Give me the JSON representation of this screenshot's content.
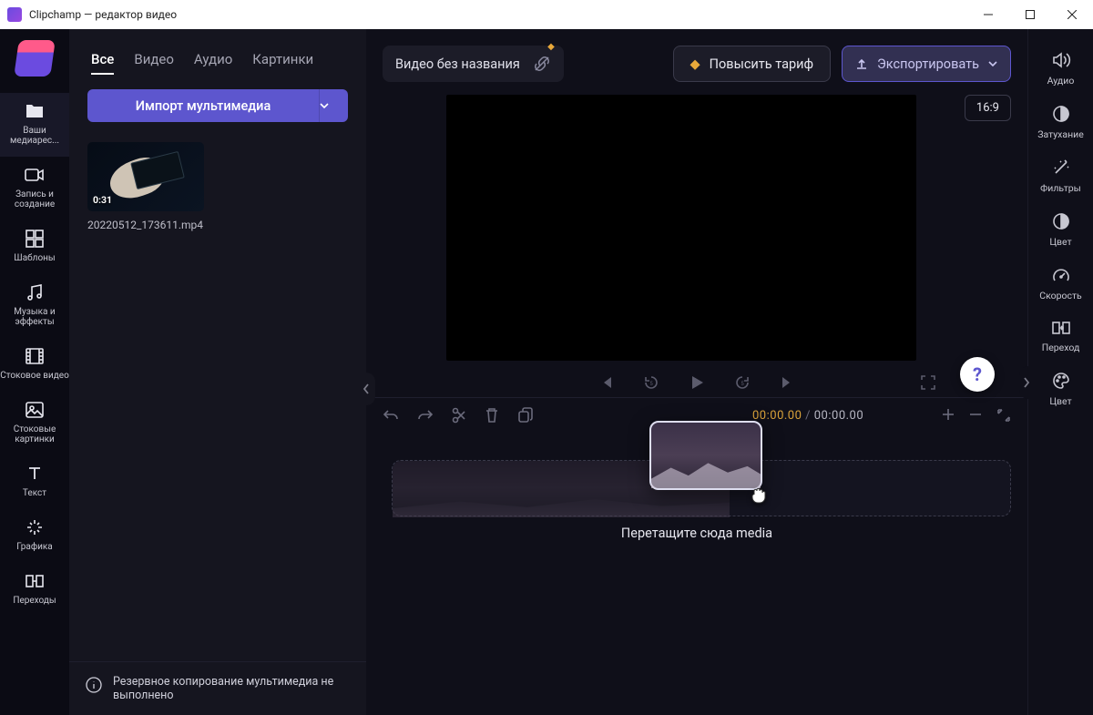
{
  "titlebar": {
    "title": "Clipchamp — редактор видео"
  },
  "leftnav": {
    "items": [
      {
        "label": "Ваши медиарес..."
      },
      {
        "label": "Запись и создание"
      },
      {
        "label": "Шаблоны"
      },
      {
        "label": "Музыка и эффекты"
      },
      {
        "label": "Стоковое видео"
      },
      {
        "label": "Стоковые картинки"
      },
      {
        "label": "Текст"
      },
      {
        "label": "Графика"
      },
      {
        "label": "Переходы"
      }
    ]
  },
  "mediapanel": {
    "tabs": [
      {
        "label": "Все"
      },
      {
        "label": "Видео"
      },
      {
        "label": "Аудио"
      },
      {
        "label": "Картинки"
      }
    ],
    "import_label": "Импорт мультимедиа",
    "items": [
      {
        "filename": "20220512_173611.mp4",
        "duration": "0:31"
      }
    ],
    "backup_text": "Резервное копирование мультимедиа не выполнено"
  },
  "topbar": {
    "title": "Видео без названия",
    "upgrade": "Повысить тариф",
    "export": "Экспортировать",
    "ratio": "16:9"
  },
  "timeline": {
    "time_current": "00:00.00",
    "time_total": "00:00.00",
    "drop_hint": "Перетащите сюда media"
  },
  "rightbar": {
    "items": [
      {
        "label": "Аудио"
      },
      {
        "label": "Затухание"
      },
      {
        "label": "Фильтры"
      },
      {
        "label": "Цвет"
      },
      {
        "label": "Скорость"
      },
      {
        "label": "Переход"
      },
      {
        "label": "Цвет"
      }
    ]
  },
  "help": "?"
}
